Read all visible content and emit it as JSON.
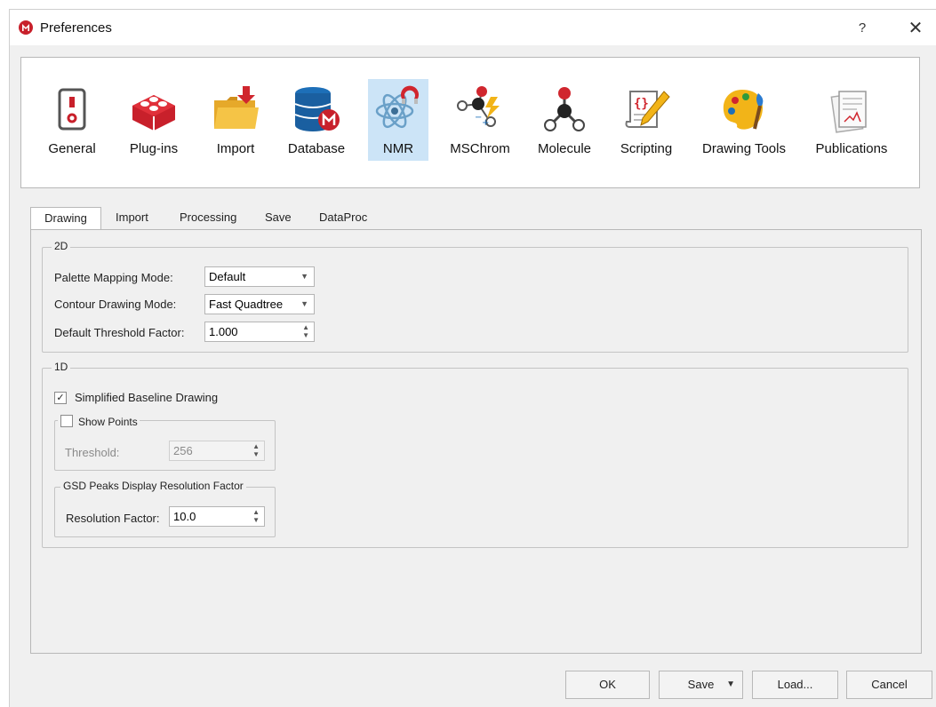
{
  "window": {
    "title": "Preferences",
    "help": "?",
    "close": "✕"
  },
  "categories": [
    {
      "label": "General",
      "icon": "power-switch-icon"
    },
    {
      "label": "Plug-ins",
      "icon": "plugin-bricks-icon"
    },
    {
      "label": "Import",
      "icon": "import-folder-icon"
    },
    {
      "label": "Database",
      "icon": "database-icon"
    },
    {
      "label": "NMR",
      "icon": "nmr-atom-magnet-icon",
      "selected": true
    },
    {
      "label": "MSChrom",
      "icon": "mschrom-molecule-icon"
    },
    {
      "label": "Molecule",
      "icon": "molecule-icon"
    },
    {
      "label": "Scripting",
      "icon": "script-pen-icon"
    },
    {
      "label": "Drawing Tools",
      "icon": "palette-icon"
    },
    {
      "label": "Publications",
      "icon": "publications-icon"
    }
  ],
  "tabs": [
    "Drawing",
    "Import",
    "Processing",
    "Save",
    "DataProc"
  ],
  "active_tab": "Drawing",
  "group_2d": {
    "title": "2D",
    "palette_label": "Palette Mapping Mode:",
    "palette_value": "Default",
    "contour_label": "Contour Drawing Mode:",
    "contour_value": "Fast Quadtree",
    "threshold_label": "Default Threshold Factor:",
    "threshold_value": "1.000"
  },
  "group_1d": {
    "title": "1D",
    "simplified_label": "Simplified Baseline Drawing",
    "simplified_checked": true,
    "show_points": {
      "title": "Show Points",
      "checked": false,
      "threshold_label": "Threshold:",
      "threshold_value": "256"
    },
    "gsd": {
      "title": "GSD Peaks Display Resolution Factor",
      "resolution_label": "Resolution Factor:",
      "resolution_value": "10.0"
    }
  },
  "buttons": {
    "ok": "OK",
    "save": "Save",
    "load": "Load...",
    "cancel": "Cancel"
  },
  "colors": {
    "accent": "#c8202b",
    "selected_bg": "#cce4f7"
  }
}
